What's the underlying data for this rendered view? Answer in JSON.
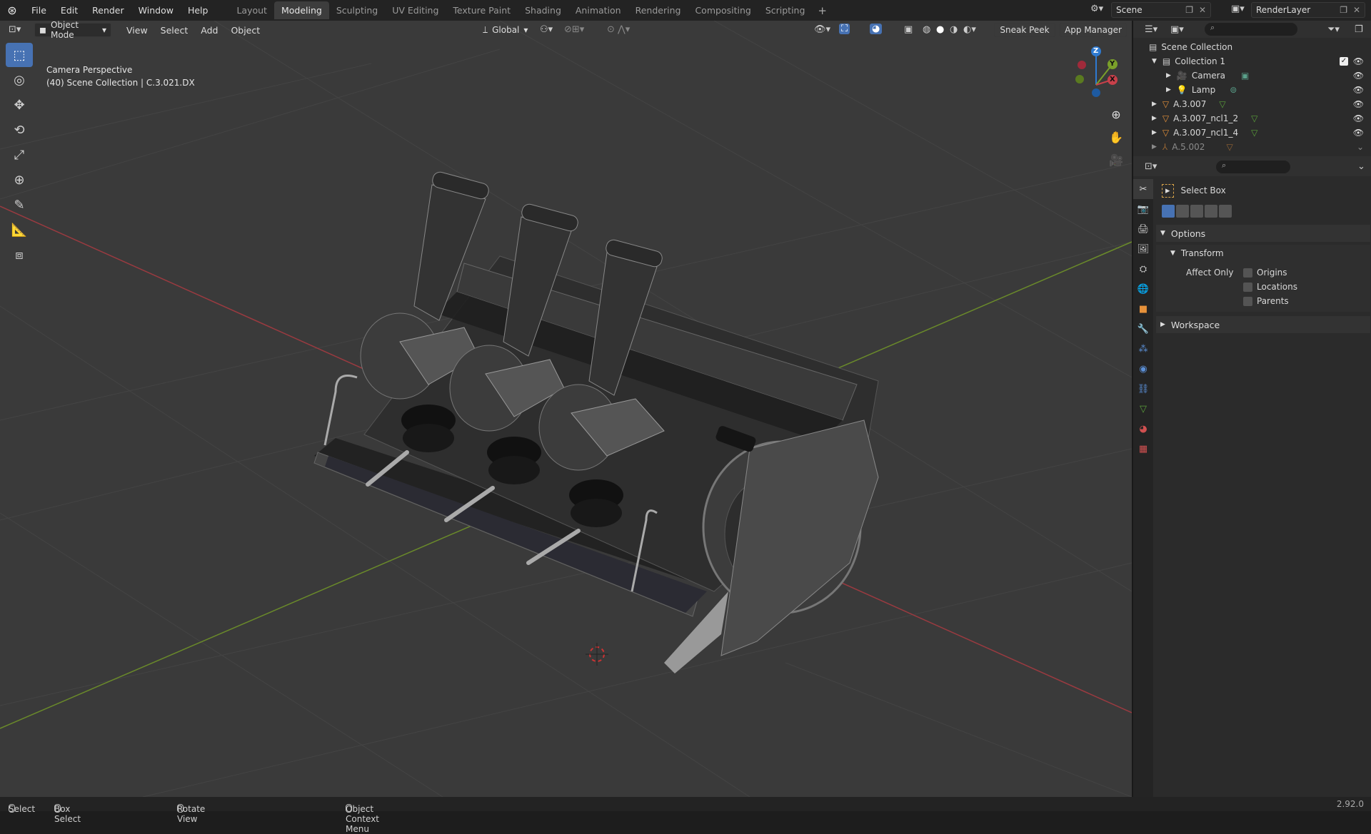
{
  "topbar": {
    "menu": [
      "File",
      "Edit",
      "Render",
      "Window",
      "Help"
    ],
    "workspaces": [
      "Layout",
      "Modeling",
      "Sculpting",
      "UV Editing",
      "Texture Paint",
      "Shading",
      "Animation",
      "Rendering",
      "Compositing",
      "Scripting"
    ],
    "active_workspace": "Modeling",
    "scene": "Scene",
    "render_layer": "RenderLayer"
  },
  "viewport_header": {
    "mode": "Object Mode",
    "menus": [
      "View",
      "Select",
      "Add",
      "Object"
    ],
    "orientation": "Global",
    "sneak_peek": "Sneak Peek",
    "app_manager": "App Manager"
  },
  "viewport": {
    "info_line1": "Camera Perspective",
    "info_line2": "(40) Scene Collection | C.3.021.DX",
    "gizmo_labels": [
      "Z",
      "Y",
      "X"
    ],
    "colors": {
      "x_axis": "#c8404a",
      "y_axis": "#7aa02a",
      "z_axis": "#2e7ad1"
    }
  },
  "outliner": {
    "root": "Scene Collection",
    "items": [
      {
        "label": "Collection 1",
        "level": 1,
        "type": "collection"
      },
      {
        "label": "Camera",
        "level": 2,
        "type": "camera"
      },
      {
        "label": "Lamp",
        "level": 2,
        "type": "light"
      },
      {
        "label": "A.3.007",
        "level": 1,
        "type": "mesh"
      },
      {
        "label": "A.3.007_ncl1_2",
        "level": 1,
        "type": "mesh"
      },
      {
        "label": "A.3.007_ncl1_4",
        "level": 1,
        "type": "mesh"
      },
      {
        "label": "A.5.002",
        "level": 1,
        "type": "mesh"
      }
    ]
  },
  "properties": {
    "tool_name": "Select Box",
    "options_label": "Options",
    "transform_label": "Transform",
    "affect_only_label": "Affect Only",
    "checkboxes": [
      "Origins",
      "Locations",
      "Parents"
    ],
    "workspace_label": "Workspace"
  },
  "statusbar": {
    "select": "Select",
    "box_select": "Box Select",
    "rotate_view": "Rotate View",
    "context_menu": "Object Context Menu",
    "version": "2.92.0"
  }
}
